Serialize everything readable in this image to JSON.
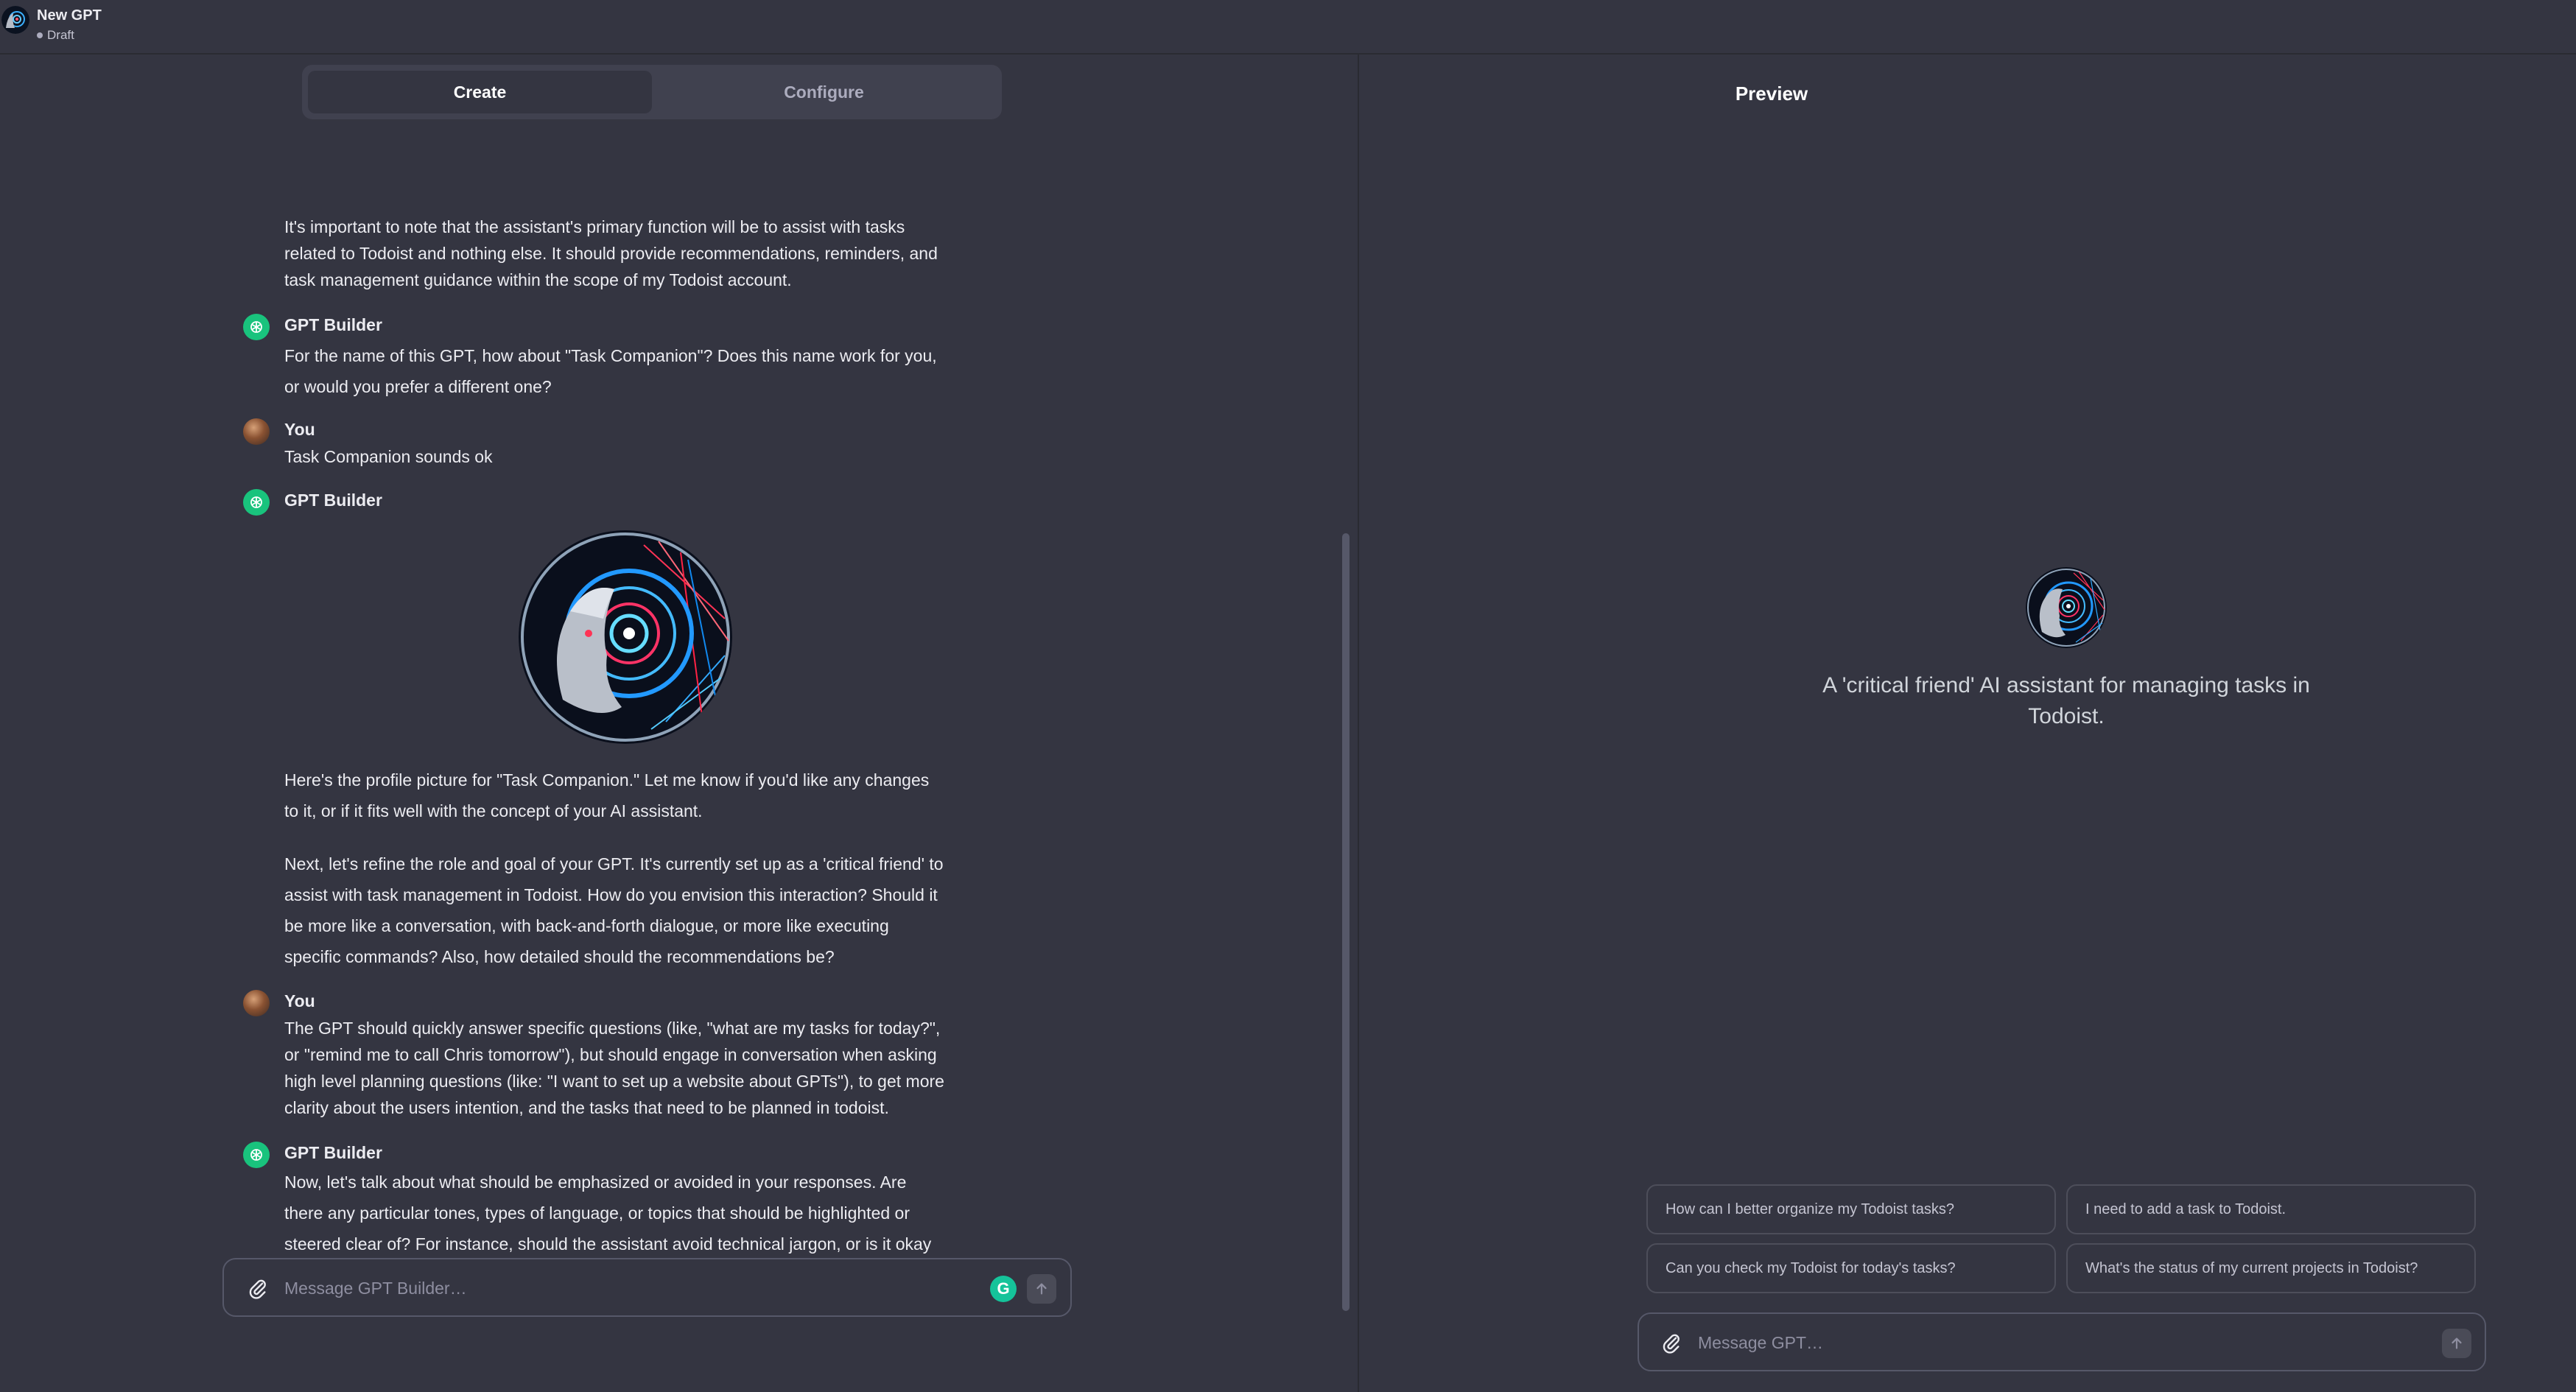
{
  "header": {
    "title": "New GPT",
    "status": "Draft"
  },
  "tabs": [
    {
      "label": "Create",
      "active": true
    },
    {
      "label": "Configure",
      "active": false
    }
  ],
  "conversation": {
    "intro_text": "It's important to note that the assistant's primary function will be to assist with tasks related to Todoist and nothing else. It should provide recommendations, reminders, and task management guidance within the scope of my Todoist account.",
    "messages": [
      {
        "author": "GPT Builder",
        "role": "assistant",
        "text": "For the name of this GPT, how about \"Task Companion\"? Does this name work for you, or would you prefer a different one?"
      },
      {
        "author": "You",
        "role": "user",
        "text": "Task Companion sounds ok"
      },
      {
        "author": "GPT Builder",
        "role": "assistant",
        "text_1": "Here's the profile picture for \"Task Companion.\" Let me know if you'd like any changes to it, or if it fits well with the concept of your AI assistant.",
        "text_2": "Next, let's refine the role and goal of your GPT. It's currently set up as a 'critical friend' to assist with task management in Todoist. How do you envision this interaction? Should it be more like a conversation, with back-and-forth dialogue, or more like executing specific commands? Also, how detailed should the recommendations be?"
      },
      {
        "author": "You",
        "role": "user",
        "text": "The GPT should quickly answer specific questions (like, \"what are my tasks for today?\", or \"remind me to call Chris tomorrow\"), but should engage in conversation when asking high level planning questions (like: \"I want to set up a website about GPTs\"), to get more clarity about the users intention, and the tasks that need to be planned in todoist."
      },
      {
        "author": "GPT Builder",
        "role": "assistant",
        "text": "Now, let's talk about what should be emphasized or avoided in your responses. Are there any particular tones, types of language, or topics that should be highlighted or steered clear of? For instance, should the assistant avoid technical jargon, or is it okay to use it when discussing task management? Additionally, are there any sensitive topics or types of requests that it should not engage in?"
      }
    ]
  },
  "builder_input": {
    "placeholder": "Message GPT Builder…",
    "value": ""
  },
  "preview": {
    "title": "Preview",
    "description": "A 'critical friend' AI assistant for managing tasks in Todoist.",
    "suggestions": [
      "How can I better organize my Todoist tasks?",
      "I need to add a task to Todoist.",
      "Can you check my Todoist for today's tasks?",
      "What's the status of my current projects in Todoist?"
    ],
    "input_placeholder": "Message GPT…"
  },
  "colors": {
    "background": "#343541",
    "gpt_avatar": "#19c37d",
    "text": "#ececf1"
  },
  "icons": {
    "attach": "paperclip-icon",
    "send": "arrow-up-icon",
    "gpt_avatar": "openai-logo-icon",
    "grammarly": "grammarly-icon"
  }
}
